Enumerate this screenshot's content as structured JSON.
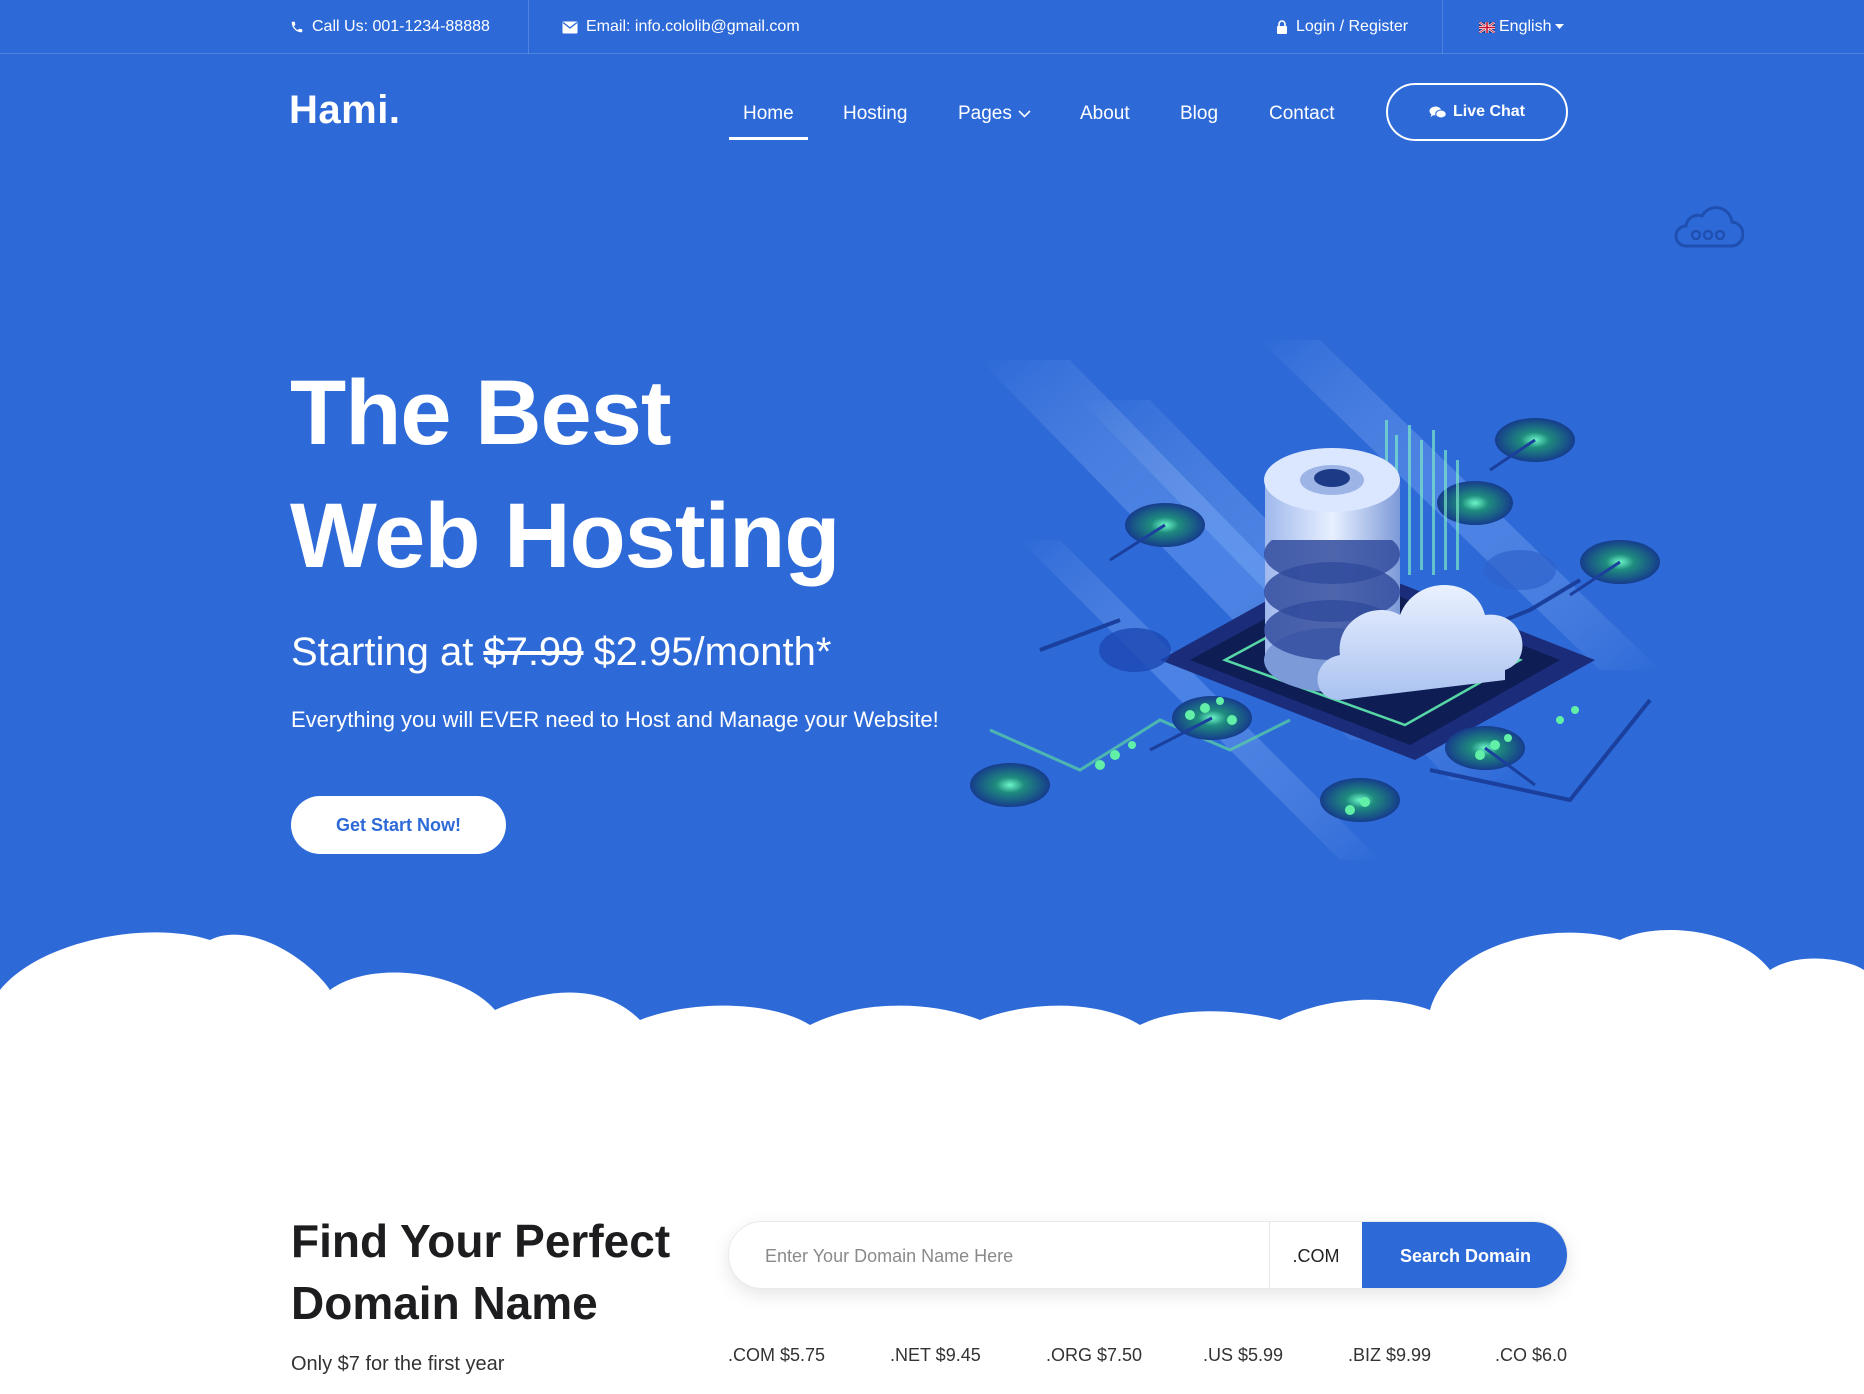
{
  "topbar": {
    "phone": "Call Us: 001-1234-88888",
    "email": "Email: info.cololib@gmail.com",
    "login": "Login / Register",
    "language": "English"
  },
  "brand": {
    "logo": "Hami."
  },
  "nav": {
    "items": [
      "Home",
      "Hosting",
      "Pages",
      "About",
      "Blog",
      "Contact"
    ],
    "active": "Home",
    "live_chat": "Live Chat"
  },
  "hero": {
    "title_line1": "The Best",
    "title_line2": "Web Hosting",
    "starting_prefix": "Starting at",
    "old_price": "$7.99",
    "new_price": "$2.95/month*",
    "subtitle": "Everything you will EVER need to Host and Manage your Website!",
    "cta": "Get Start Now!"
  },
  "domain": {
    "title_line1": "Find Your Perfect",
    "title_line2": "Domain Name",
    "note": "Only $7 for the first year",
    "search_placeholder": "Enter Your Domain Name Here",
    "tld_selected": ".COM",
    "search_button": "Search Domain",
    "prices": [
      ".COM $5.75",
      ".NET $9.45",
      ".ORG $7.50",
      ".US $5.99",
      ".BIZ $9.99",
      ".CO $6.0"
    ]
  },
  "icons": [
    "phone-icon",
    "envelope-icon",
    "lock-icon",
    "uk-flag-icon",
    "caret-down-icon",
    "chevron-down-icon",
    "chat-bubbles-icon",
    "cloud-icon"
  ],
  "colors": {
    "primary": "#2d6ad8",
    "white": "#ffffff",
    "text_dark": "#1d1d1f"
  }
}
